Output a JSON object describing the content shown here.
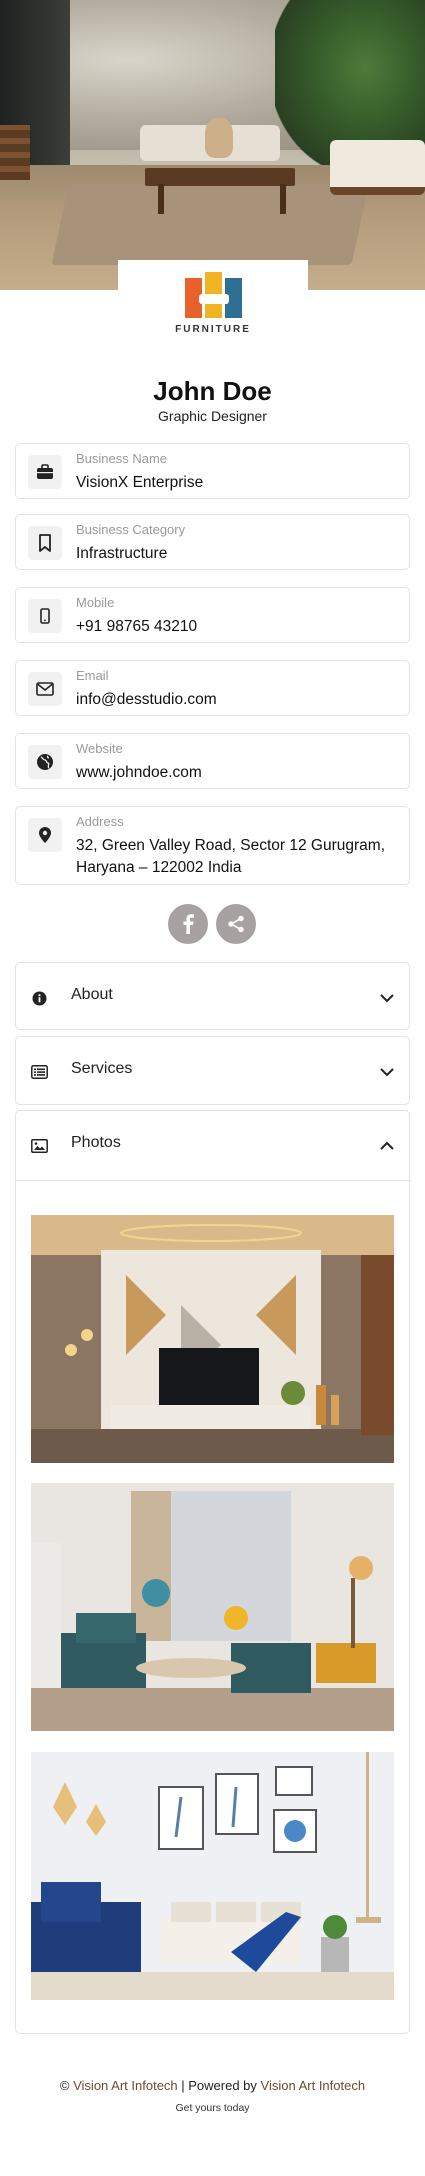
{
  "brand": {
    "logo_word": "FURNITURE",
    "colors": {
      "orange": "#e8602a",
      "blue": "#2e6f93",
      "yellow": "#f0b323",
      "red": "#d9432b"
    }
  },
  "profile": {
    "name": "John Doe",
    "role": "Graphic Designer"
  },
  "fields": [
    {
      "icon": "briefcase-icon",
      "label": "Business Name",
      "value": "VisionX Enterprise"
    },
    {
      "icon": "bookmark-icon",
      "label": "Business Category",
      "value": "Infrastructure"
    },
    {
      "icon": "mobile-phone-icon",
      "label": "Mobile",
      "value": "+91 98765 43210"
    },
    {
      "icon": "envelope-icon",
      "label": "Email",
      "value": "info@desstudio.com"
    },
    {
      "icon": "globe-icon",
      "label": "Website",
      "value": "www.johndoe.com"
    },
    {
      "icon": "location-pin-icon",
      "label": "Address",
      "value": "32, Green Valley Road, Sector 12 Gurugram, Haryana – 122002 India"
    }
  ],
  "social": [
    {
      "icon": "facebook-icon"
    },
    {
      "icon": "share-icon"
    }
  ],
  "sections": [
    {
      "icon": "info-icon",
      "label": "About",
      "state": "collapsed"
    },
    {
      "icon": "list-icon",
      "label": "Services",
      "state": "collapsed"
    },
    {
      "icon": "image-icon",
      "label": "Photos",
      "state": "expanded"
    }
  ],
  "photos": [
    {
      "subject": "tv-wall-interior"
    },
    {
      "subject": "living-room-teal-chairs"
    },
    {
      "subject": "white-room-blue-armchair"
    }
  ],
  "footer": {
    "prefix": "© ",
    "company": "Vision Art Infotech",
    "powered": " | Powered by ",
    "powered_company": "Vision Art Infotech",
    "tagline": "Get yours today"
  }
}
